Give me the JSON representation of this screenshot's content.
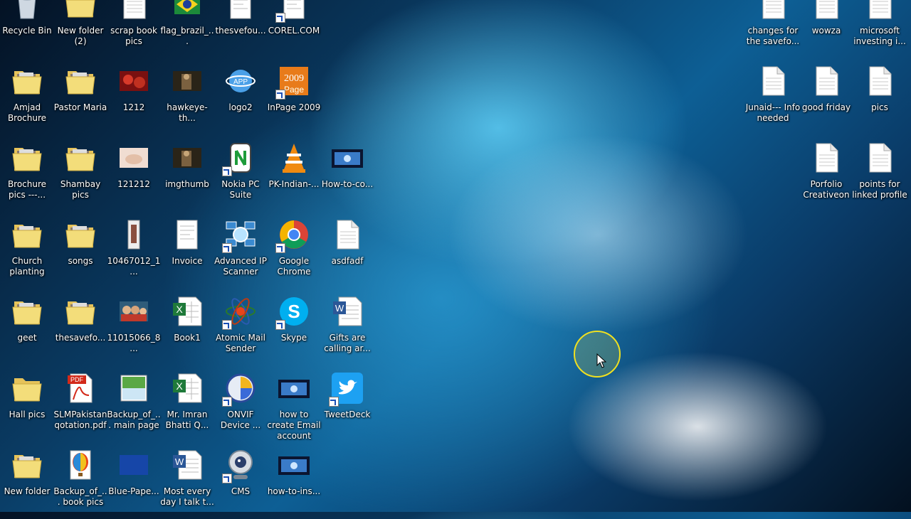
{
  "desktop": {
    "icons": [
      {
        "label": "Recycle Bin",
        "type": "recycle",
        "col": 0,
        "row": 0
      },
      {
        "label": "New folder (2)",
        "type": "folder",
        "col": 1,
        "row": 0
      },
      {
        "label": "scrap book pics",
        "type": "file",
        "col": 2,
        "row": 0
      },
      {
        "label": "flag_brazil_...",
        "type": "image",
        "col": 3,
        "row": 0
      },
      {
        "label": "thesvefou...",
        "type": "doc",
        "col": 4,
        "row": 0
      },
      {
        "label": "COREL.COM",
        "type": "doc",
        "col": 5,
        "row": 0,
        "shortcut": true
      },
      {
        "label": "Amjad Brochure",
        "type": "folder",
        "col": 0,
        "row": 1
      },
      {
        "label": "Pastor Maria",
        "type": "folder",
        "col": 1,
        "row": 1
      },
      {
        "label": "1212",
        "type": "photo-red",
        "col": 2,
        "row": 1
      },
      {
        "label": "hawkeye-th...",
        "type": "photo-dark",
        "col": 3,
        "row": 1
      },
      {
        "label": "logo2",
        "type": "logo",
        "col": 4,
        "row": 1
      },
      {
        "label": "InPage 2009",
        "type": "inpage",
        "col": 5,
        "row": 1,
        "shortcut": true
      },
      {
        "label": "Brochure pics ---...",
        "type": "folder",
        "col": 0,
        "row": 2
      },
      {
        "label": "Shambay pics",
        "type": "folder",
        "col": 1,
        "row": 2
      },
      {
        "label": "121212",
        "type": "photo-light",
        "col": 2,
        "row": 2
      },
      {
        "label": "imgthumb",
        "type": "photo-dark",
        "col": 3,
        "row": 2
      },
      {
        "label": "Nokia PC Suite",
        "type": "nokia",
        "col": 4,
        "row": 2,
        "shortcut": true
      },
      {
        "label": "PK-Indian-...",
        "type": "vlc",
        "col": 5,
        "row": 2
      },
      {
        "label": "How-to-co...",
        "type": "video",
        "col": 6,
        "row": 2
      },
      {
        "label": "Church planting",
        "type": "folder",
        "col": 0,
        "row": 3
      },
      {
        "label": "songs",
        "type": "folder",
        "col": 1,
        "row": 3
      },
      {
        "label": "10467012_1...",
        "type": "photo-tall",
        "col": 2,
        "row": 3
      },
      {
        "label": "Invoice",
        "type": "doc",
        "col": 3,
        "row": 3
      },
      {
        "label": "Advanced IP Scanner",
        "type": "ipscan",
        "col": 4,
        "row": 3,
        "shortcut": true
      },
      {
        "label": "Google Chrome",
        "type": "chrome",
        "col": 5,
        "row": 3,
        "shortcut": true
      },
      {
        "label": "asdfadf",
        "type": "file",
        "col": 6,
        "row": 3
      },
      {
        "label": "geet",
        "type": "folder",
        "col": 0,
        "row": 4
      },
      {
        "label": "thesavefo...",
        "type": "folder",
        "col": 1,
        "row": 4
      },
      {
        "label": "11015066_8...",
        "type": "photo-kids",
        "col": 2,
        "row": 4
      },
      {
        "label": "Book1",
        "type": "excel",
        "col": 3,
        "row": 4
      },
      {
        "label": "Atomic Mail Sender",
        "type": "atomic",
        "col": 4,
        "row": 4,
        "shortcut": true
      },
      {
        "label": "Skype",
        "type": "skype",
        "col": 5,
        "row": 4,
        "shortcut": true
      },
      {
        "label": "Gifts are calling ar...",
        "type": "word",
        "col": 6,
        "row": 4
      },
      {
        "label": "Hall pics",
        "type": "folder-empty",
        "col": 0,
        "row": 5
      },
      {
        "label": "SLMPakistan qotation.pdf",
        "type": "pdf",
        "col": 1,
        "row": 5
      },
      {
        "label": "Backup_of_... main page",
        "type": "photo-green",
        "col": 2,
        "row": 5
      },
      {
        "label": "Mr. Imran Bhatti Q...",
        "type": "excel",
        "col": 3,
        "row": 5
      },
      {
        "label": "ONVIF Device ...",
        "type": "onvif",
        "col": 4,
        "row": 5,
        "shortcut": true
      },
      {
        "label": "how to create Email account",
        "type": "video",
        "col": 5,
        "row": 5
      },
      {
        "label": "TweetDeck",
        "type": "twitter",
        "col": 6,
        "row": 5,
        "shortcut": true
      },
      {
        "label": "New folder",
        "type": "folder",
        "col": 0,
        "row": 6
      },
      {
        "label": "Backup_of_... book pics",
        "type": "balloon",
        "col": 1,
        "row": 6
      },
      {
        "label": "Blue-Pape...",
        "type": "photo-blue",
        "col": 2,
        "row": 6
      },
      {
        "label": "Most every day I talk t...",
        "type": "word",
        "col": 3,
        "row": 6
      },
      {
        "label": "CMS",
        "type": "webcam",
        "col": 4,
        "row": 6,
        "shortcut": true
      },
      {
        "label": "how-to-ins...",
        "type": "video",
        "col": 5,
        "row": 6
      }
    ],
    "right_icons": [
      {
        "label": "changes for the savefo...",
        "type": "file",
        "col": 0,
        "row": 0
      },
      {
        "label": "wowza",
        "type": "file",
        "col": 1,
        "row": 0
      },
      {
        "label": "microsoft investing i...",
        "type": "file",
        "col": 2,
        "row": 0
      },
      {
        "label": "Junaid--- Info needed",
        "type": "file",
        "col": 0,
        "row": 1
      },
      {
        "label": "good friday",
        "type": "file",
        "col": 1,
        "row": 1
      },
      {
        "label": "pics",
        "type": "file",
        "col": 2,
        "row": 1
      },
      {
        "label": "Porfolio Creativeon",
        "type": "file",
        "col": 1,
        "row": 2
      },
      {
        "label": "points for linked profile",
        "type": "file",
        "col": 2,
        "row": 2
      }
    ]
  }
}
